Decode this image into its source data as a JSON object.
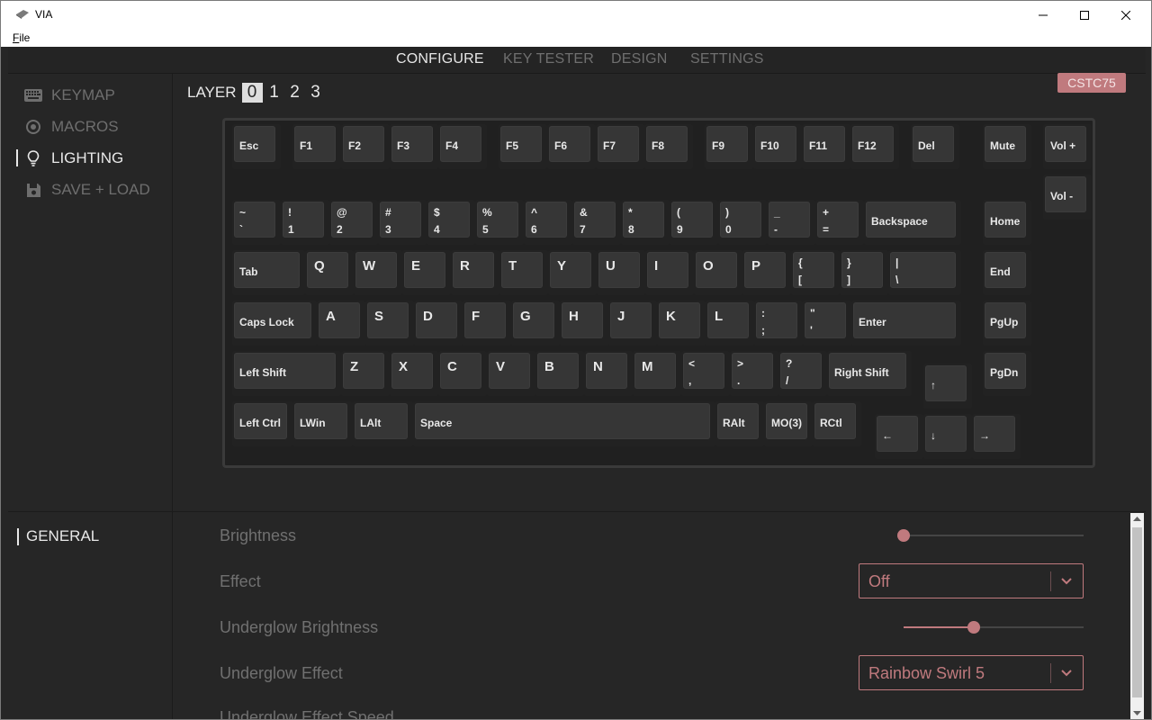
{
  "window": {
    "title": "VIA",
    "minimize": "—",
    "maximize": "□",
    "close": "✕"
  },
  "menu": {
    "file": "File"
  },
  "nav": {
    "tabs": [
      "CONFIGURE",
      "KEY TESTER",
      "DESIGN",
      "SETTINGS"
    ],
    "active": "CONFIGURE"
  },
  "sidebar": {
    "items": [
      {
        "label": "KEYMAP",
        "icon": "keyboard-icon"
      },
      {
        "label": "MACROS",
        "icon": "circle-dot-icon"
      },
      {
        "label": "LIGHTING",
        "icon": "lightbulb-icon"
      },
      {
        "label": "SAVE + LOAD",
        "icon": "floppy-disk-icon"
      }
    ],
    "active": "LIGHTING"
  },
  "layers": {
    "label": "LAYER",
    "values": [
      "0",
      "1",
      "2",
      "3"
    ],
    "selected": "0"
  },
  "keyboard_name": "CSTC75",
  "keys": {
    "esc": "Esc",
    "f1": "F1",
    "f2": "F2",
    "f3": "F3",
    "f4": "F4",
    "f5": "F5",
    "f6": "F6",
    "f7": "F7",
    "f8": "F8",
    "f9": "F9",
    "f10": "F10",
    "f11": "F11",
    "f12": "F12",
    "del": "Del",
    "mute": "Mute",
    "volup": "Vol +",
    "voldown": "Vol -",
    "grave_top": "~",
    "grave_bot": "`",
    "n1_top": "!",
    "n1_bot": "1",
    "n2_top": "@",
    "n2_bot": "2",
    "n3_top": "#",
    "n3_bot": "3",
    "n4_top": "$",
    "n4_bot": "4",
    "n5_top": "%",
    "n5_bot": "5",
    "n6_top": "^",
    "n6_bot": "6",
    "n7_top": "&",
    "n7_bot": "7",
    "n8_top": "*",
    "n8_bot": "8",
    "n9_top": "(",
    "n9_bot": "9",
    "n0_top": ")",
    "n0_bot": "0",
    "minus_top": "_",
    "minus_bot": "-",
    "eq_top": "+",
    "eq_bot": "=",
    "backspace": "Backspace",
    "home": "Home",
    "tab": "Tab",
    "q": "Q",
    "w": "W",
    "e": "E",
    "r": "R",
    "t": "T",
    "y": "Y",
    "u": "U",
    "i": "I",
    "o": "O",
    "p": "P",
    "lbr_top": "{",
    "lbr_bot": "[",
    "rbr_top": "}",
    "rbr_bot": "]",
    "bs_top": "|",
    "bs_bot": "\\",
    "end": "End",
    "caps": "Caps Lock",
    "a": "A",
    "s": "S",
    "d": "D",
    "f": "F",
    "g": "G",
    "h": "H",
    "j": "J",
    "k": "K",
    "l": "L",
    "semi_top": ":",
    "semi_bot": ";",
    "quote_top": "\"",
    "quote_bot": "'",
    "enter": "Enter",
    "pgup": "PgUp",
    "lshift": "Left Shift",
    "z": "Z",
    "x": "X",
    "c": "C",
    "v": "V",
    "b": "B",
    "n": "N",
    "m": "M",
    "comma_top": "<",
    "comma_bot": ",",
    "dot_top": ">",
    "dot_bot": ".",
    "slash_top": "?",
    "slash_bot": "/",
    "rshift": "Right Shift",
    "up": "↑",
    "pgdn": "PgDn",
    "lctrl": "Left Ctrl",
    "lwin": "LWin",
    "lalt": "LAlt",
    "space": "Space",
    "ralt": "RAlt",
    "mo3": "MO(3)",
    "rctl": "RCtl",
    "left": "←",
    "down": "↓",
    "right": "→"
  },
  "lower_menu": {
    "general": "GENERAL"
  },
  "settings": {
    "brightness": {
      "label": "Brightness",
      "value_fraction": 0.0
    },
    "effect": {
      "label": "Effect",
      "value": "Off"
    },
    "underglow_brightness": {
      "label": "Underglow Brightness",
      "value_fraction": 0.39
    },
    "underglow_effect": {
      "label": "Underglow Effect",
      "value": "Rainbow Swirl 5"
    },
    "underglow_effect_speed": {
      "label": "Underglow Effect Speed"
    }
  },
  "colors": {
    "accent": "#c07a7e",
    "background": "#262626",
    "keycap": "#363636",
    "text_muted": "#707070",
    "text_active": "#e8e8e8"
  }
}
